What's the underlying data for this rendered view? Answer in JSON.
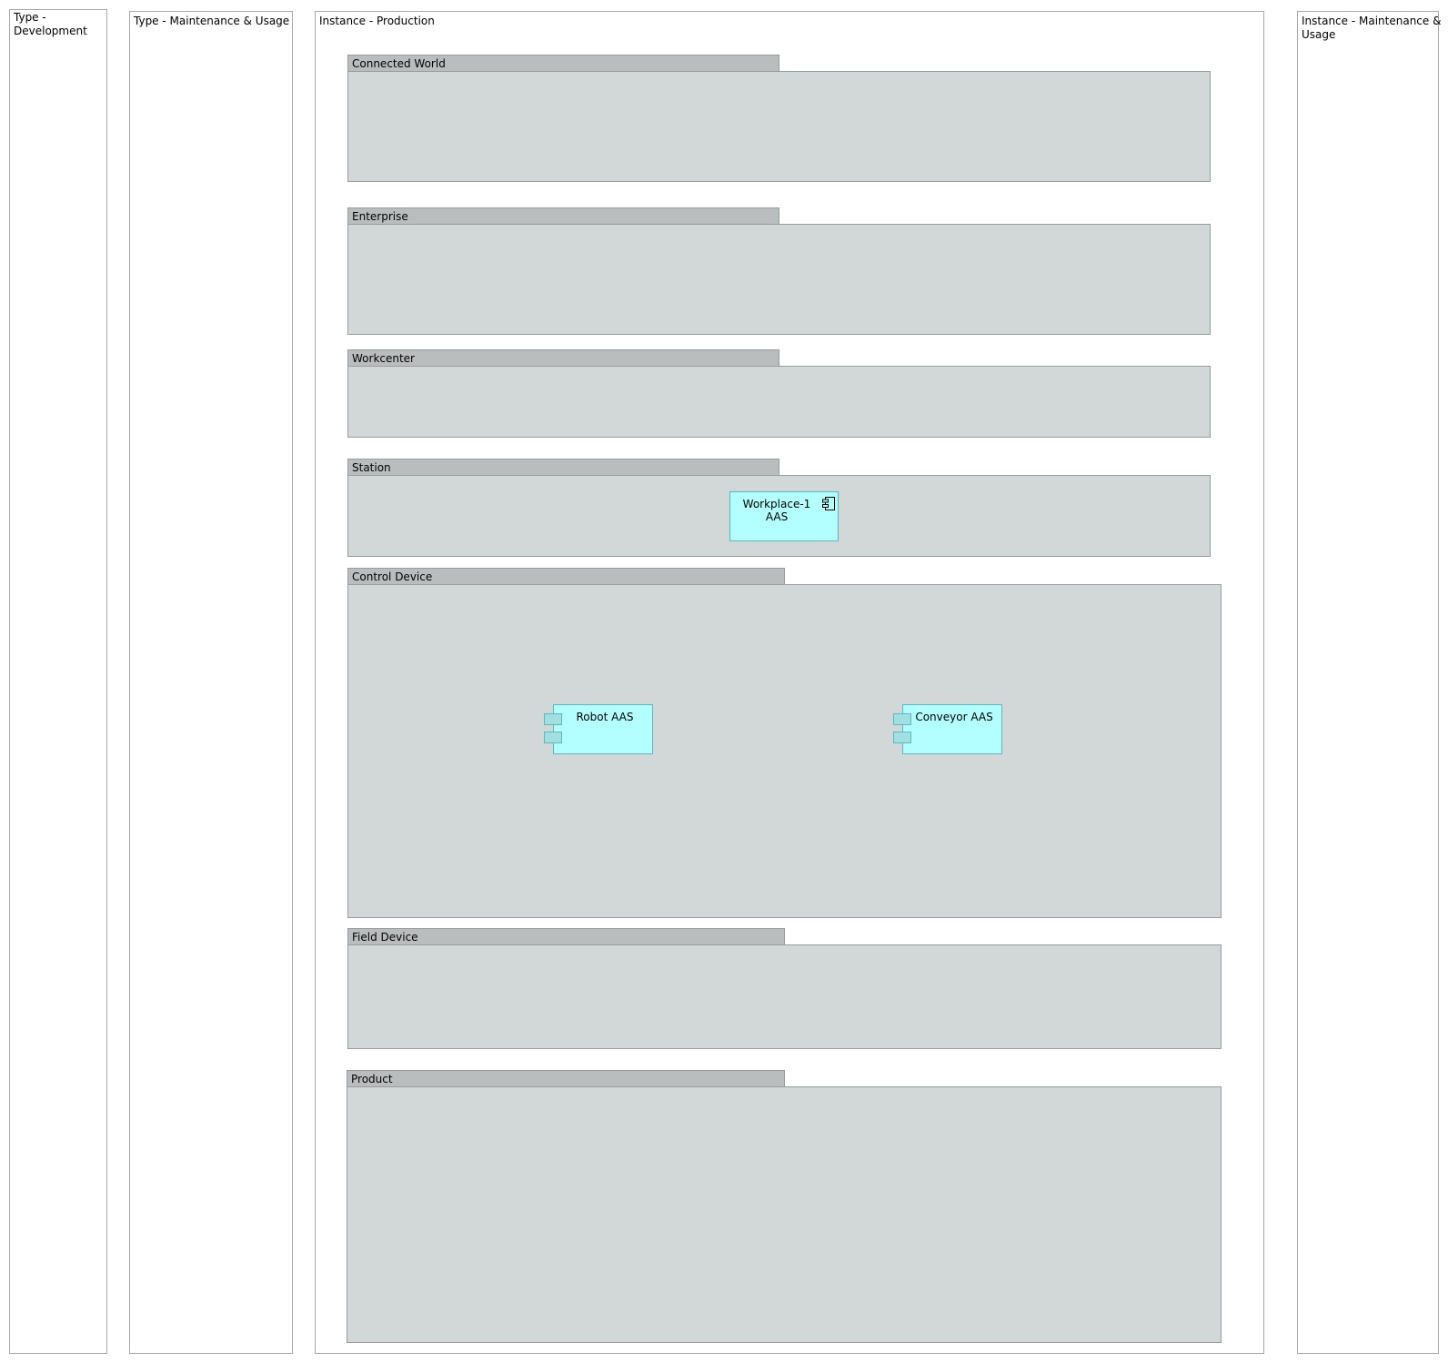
{
  "columns": {
    "type_development": "Type -\nDevelopment",
    "type_maintenance": "Type - Maintenance & Usage",
    "instance_production": "Instance - Production",
    "instance_maintenance": "Instance - Maintenance &\nUsage"
  },
  "groups": {
    "connected_world": "Connected World",
    "enterprise": "Enterprise",
    "workcenter": "Workcenter",
    "station": "Station",
    "control_device": "Control Device",
    "field_device": "Field Device",
    "product": "Product"
  },
  "components": {
    "workplace": "Workplace-1\nAAS",
    "robot": "Robot AAS",
    "conveyor": "Conveyor AAS"
  },
  "colors": {
    "group_tab": "#babdbe",
    "group_body": "#d2d7d7",
    "component_fill": "#b3ffff",
    "component_border": "#5cb8c0"
  },
  "icons": {
    "component_icon": "component-icon"
  }
}
